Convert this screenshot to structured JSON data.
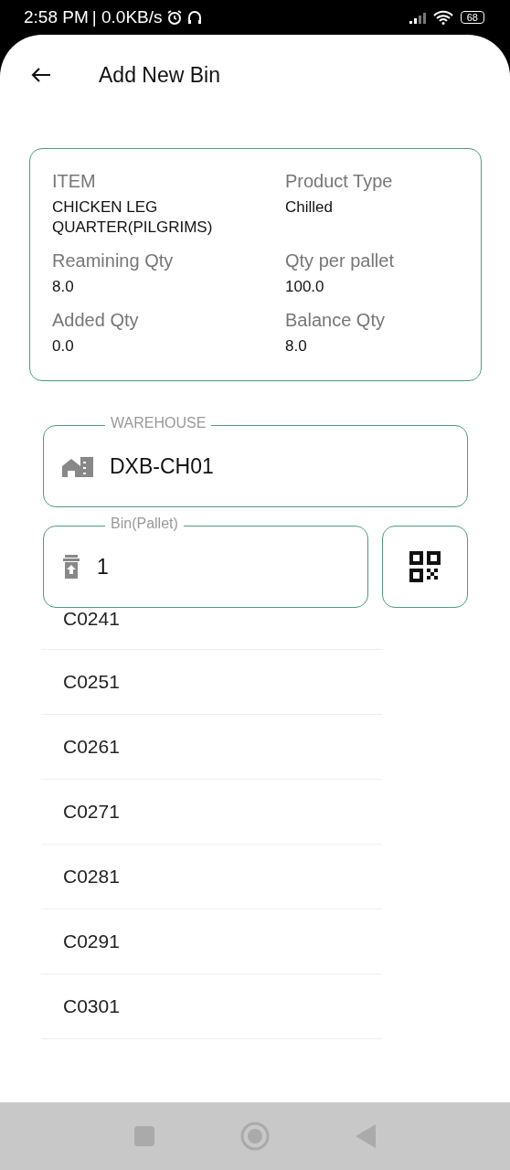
{
  "status_bar": {
    "time": "2:58 PM",
    "speed": "| 0.0KB/s",
    "battery": "68"
  },
  "header": {
    "title": "Add New Bin"
  },
  "item_card": {
    "fields": [
      {
        "label": "ITEM",
        "value": "CHICKEN LEG QUARTER(PILGRIMS)"
      },
      {
        "label": "Product Type",
        "value": "Chilled"
      },
      {
        "label": "Reamining Qty",
        "value": "8.0"
      },
      {
        "label": "Qty per pallet",
        "value": "100.0"
      },
      {
        "label": "Added Qty",
        "value": "0.0"
      },
      {
        "label": "Balance Qty",
        "value": "8.0"
      }
    ]
  },
  "warehouse_field": {
    "label": "WAREHOUSE",
    "value": "DXB-CH01"
  },
  "bin_field": {
    "label": "Bin(Pallet)",
    "value": "1"
  },
  "bin_suggestions": [
    "C0241",
    "C0251",
    "C0261",
    "C0271",
    "C0281",
    "C0291",
    "C0301"
  ]
}
